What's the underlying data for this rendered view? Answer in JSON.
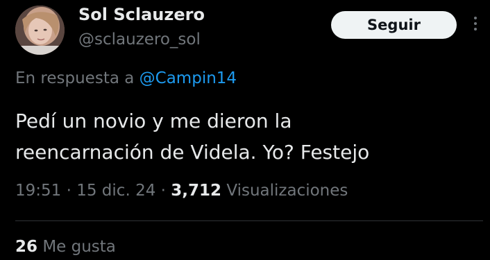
{
  "author": {
    "display_name": "Sol Sclauzero",
    "handle": "@sclauzero_sol"
  },
  "follow_button": {
    "label": "Seguir"
  },
  "more_icon": "more-vertical-icon",
  "reply": {
    "prefix": "En respuesta a",
    "mention": "@Campin14"
  },
  "tweet": {
    "text_line_1": "Pedí un novio y me dieron la",
    "text_line_2": "reencarnación de Videla. Yo? Festejo"
  },
  "meta": {
    "time": "19:51",
    "separator_1": "·",
    "date": "15 dic. 24",
    "separator_2": "·",
    "views_count": "3,712",
    "views_label": "Visualizaciones"
  },
  "stats": {
    "likes_count": "26",
    "likes_label": "Me gusta"
  },
  "colors": {
    "background": "#000000",
    "primary_text": "#e7e9ea",
    "secondary_text": "#71767b",
    "link": "#1d9bf0",
    "follow_button_bg": "#eff3f4",
    "divider": "#2f3336"
  }
}
